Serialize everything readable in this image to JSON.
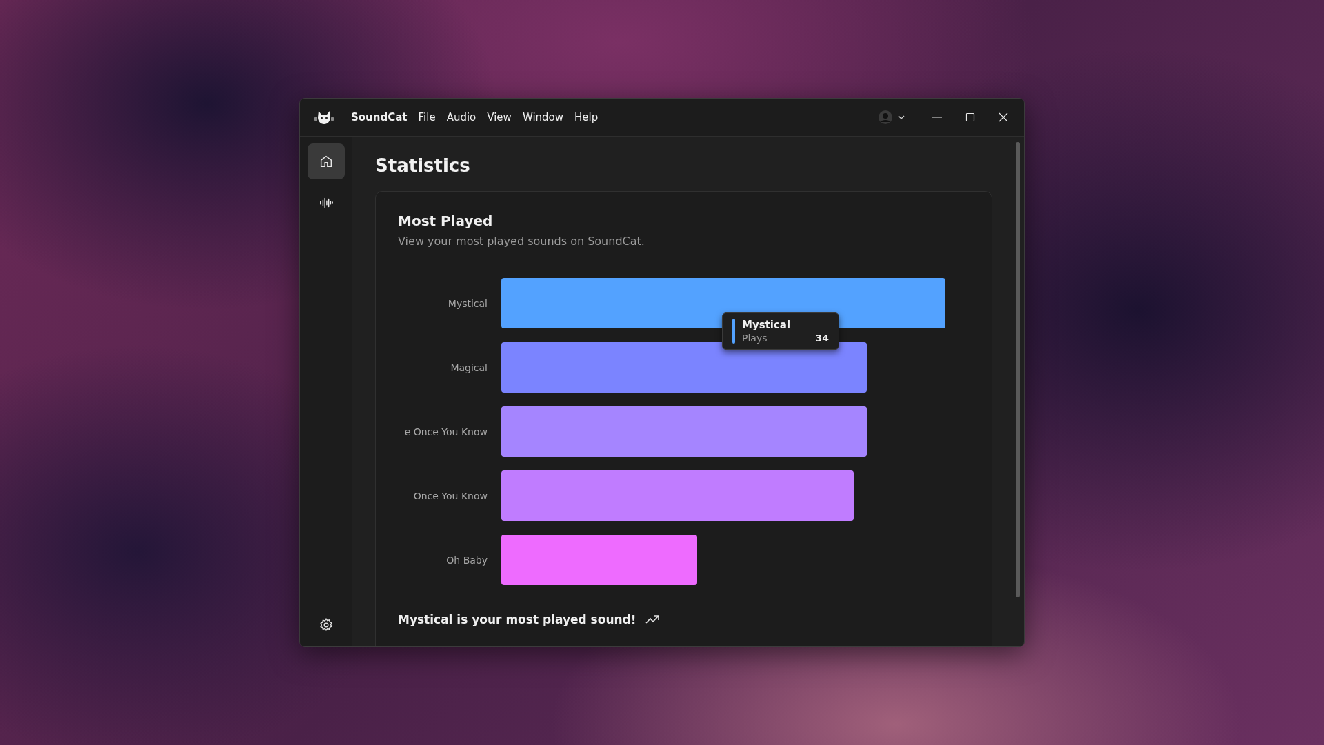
{
  "app": {
    "name": "SoundCat"
  },
  "menu": [
    {
      "label": "File"
    },
    {
      "label": "Audio"
    },
    {
      "label": "View"
    },
    {
      "label": "Window"
    },
    {
      "label": "Help"
    }
  ],
  "sidebar": {
    "items": [
      {
        "kind": "home",
        "selected": true
      },
      {
        "kind": "waveform",
        "selected": false
      }
    ]
  },
  "page": {
    "title": "Statistics"
  },
  "card": {
    "title": "Most Played",
    "subtitle": "View your most played sounds on SoundCat.",
    "bars": [
      {
        "label": "Mystical",
        "color": "#53a2ff"
      },
      {
        "label": "Magical",
        "color": "#7b84ff"
      },
      {
        "label": "e Once You Know",
        "color": "#a585ff"
      },
      {
        "label": "Once You Know",
        "color": "#c07cff"
      },
      {
        "label": "Oh Baby",
        "color": "#ee6bff"
      }
    ],
    "tooltip": {
      "title": "Mystical",
      "label": "Plays",
      "value": "34"
    },
    "summary": "Mystical is your most played sound!"
  }
}
